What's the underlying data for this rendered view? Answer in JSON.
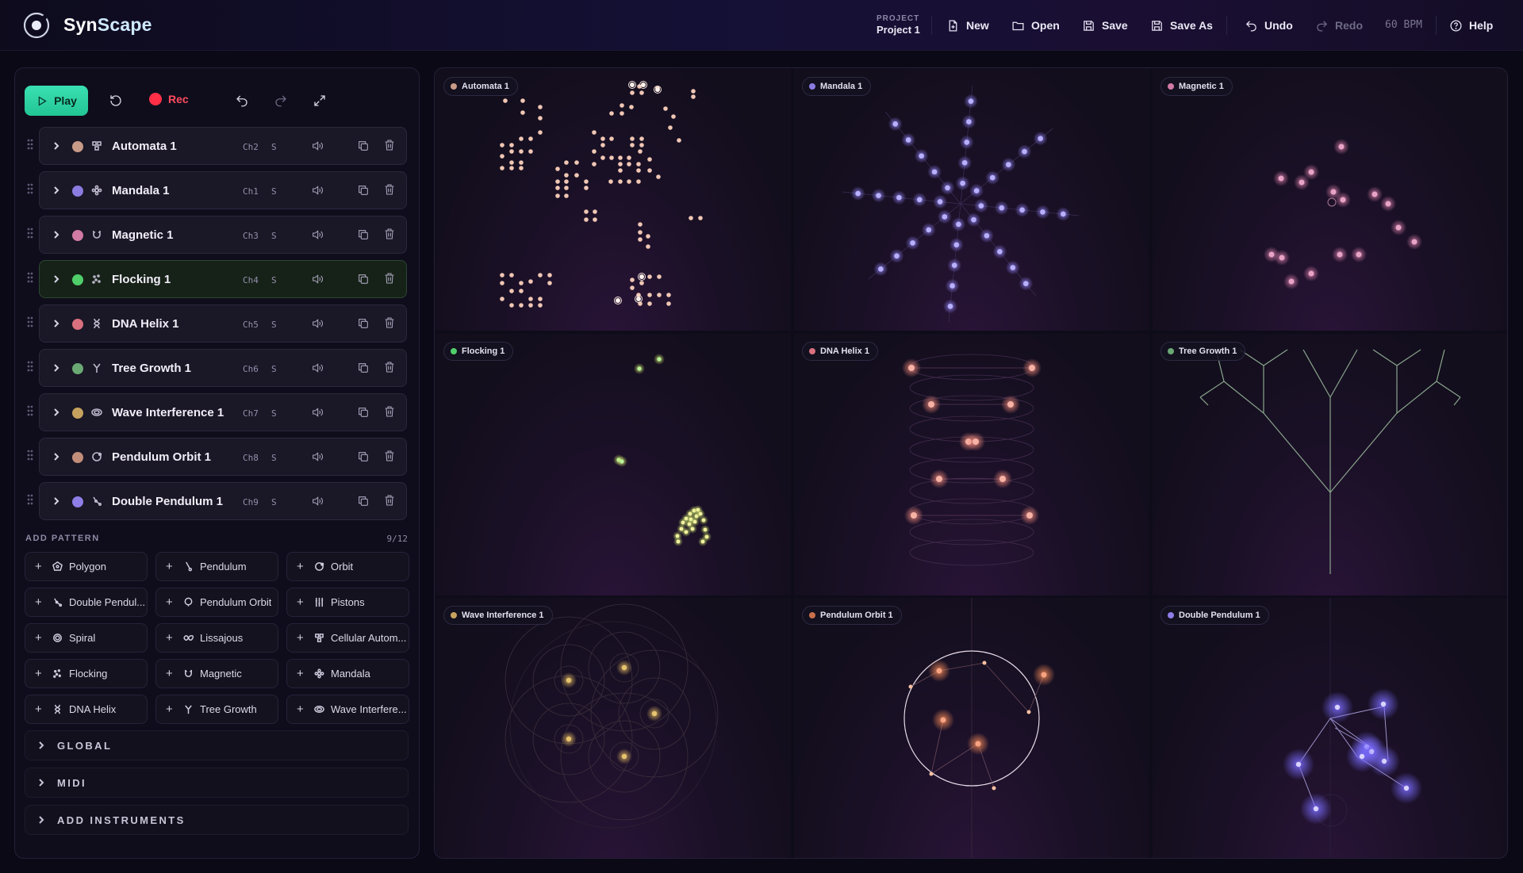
{
  "app": {
    "brand_syn": "Syn",
    "brand_scape": "Scape"
  },
  "project": {
    "label": "PROJECT",
    "name": "Project 1"
  },
  "toolbar": {
    "new": "New",
    "open": "Open",
    "save": "Save",
    "save_as": "Save As",
    "undo": "Undo",
    "redo": "Redo",
    "bpm": "60 BPM",
    "help": "Help"
  },
  "controls": {
    "play": "Play",
    "rec": "Rec"
  },
  "colors": {
    "accent": "#2bd4a4",
    "rec": "#ff2f48"
  },
  "tracks": [
    {
      "name": "Automata 1",
      "channel": "Ch2",
      "solo": "S",
      "color": "#c89a88",
      "icon": "cellular-icon"
    },
    {
      "name": "Mandala 1",
      "channel": "Ch1",
      "solo": "S",
      "color": "#8a7ce0",
      "icon": "mandala-icon"
    },
    {
      "name": "Magnetic 1",
      "channel": "Ch3",
      "solo": "S",
      "color": "#d07aa4",
      "icon": "magnet-icon"
    },
    {
      "name": "Flocking 1",
      "channel": "Ch4",
      "solo": "S",
      "color": "#4fce6a",
      "icon": "flocking-icon"
    },
    {
      "name": "DNA Helix 1",
      "channel": "Ch5",
      "solo": "S",
      "color": "#d9707e",
      "icon": "dna-icon"
    },
    {
      "name": "Tree Growth 1",
      "channel": "Ch6",
      "solo": "S",
      "color": "#6aa874",
      "icon": "tree-icon"
    },
    {
      "name": "Wave Interference 1",
      "channel": "Ch7",
      "solo": "S",
      "color": "#c6a25e",
      "icon": "wave-icon"
    },
    {
      "name": "Pendulum Orbit 1",
      "channel": "Ch8",
      "solo": "S",
      "color": "#c28e7a",
      "icon": "orbit-icon"
    },
    {
      "name": "Double Pendulum 1",
      "channel": "Ch9",
      "solo": "S",
      "color": "#8e7ee8",
      "icon": "double-pendulum-icon"
    }
  ],
  "add_pattern": {
    "title": "ADD PATTERN",
    "count": "9/12",
    "items": [
      {
        "label": "Polygon",
        "icon": "polygon-icon"
      },
      {
        "label": "Pendulum",
        "icon": "pendulum-icon"
      },
      {
        "label": "Orbit",
        "icon": "orbit-icon"
      },
      {
        "label": "Double Pendul...",
        "icon": "double-pendulum-icon"
      },
      {
        "label": "Pendulum Orbit",
        "icon": "pendulum-orbit-icon"
      },
      {
        "label": "Pistons",
        "icon": "pistons-icon"
      },
      {
        "label": "Spiral",
        "icon": "spiral-icon"
      },
      {
        "label": "Lissajous",
        "icon": "lissajous-icon"
      },
      {
        "label": "Cellular Autom...",
        "icon": "cellular-icon"
      },
      {
        "label": "Flocking",
        "icon": "flocking-icon"
      },
      {
        "label": "Magnetic",
        "icon": "magnet-icon"
      },
      {
        "label": "Mandala",
        "icon": "mandala-icon"
      },
      {
        "label": "DNA Helix",
        "icon": "dna-icon"
      },
      {
        "label": "Tree Growth",
        "icon": "tree-icon"
      },
      {
        "label": "Wave Interfere...",
        "icon": "wave-icon"
      }
    ]
  },
  "sections": {
    "global": "GLOBAL",
    "midi": "MIDI",
    "instruments": "ADD INSTRUMENTS"
  },
  "canvases": [
    {
      "label": "Automata 1",
      "color": "#c89a88"
    },
    {
      "label": "Mandala 1",
      "color": "#8a7ce0"
    },
    {
      "label": "Magnetic 1",
      "color": "#d07aa4"
    },
    {
      "label": "Flocking 1",
      "color": "#4fce6a"
    },
    {
      "label": "DNA Helix 1",
      "color": "#d9707e"
    },
    {
      "label": "Tree Growth 1",
      "color": "#6aa874"
    },
    {
      "label": "Wave Interference 1",
      "color": "#c6a25e"
    },
    {
      "label": "Pendulum Orbit 1",
      "color": "#c8704a"
    },
    {
      "label": "Double Pendulum 1",
      "color": "#8e7ee8"
    }
  ]
}
